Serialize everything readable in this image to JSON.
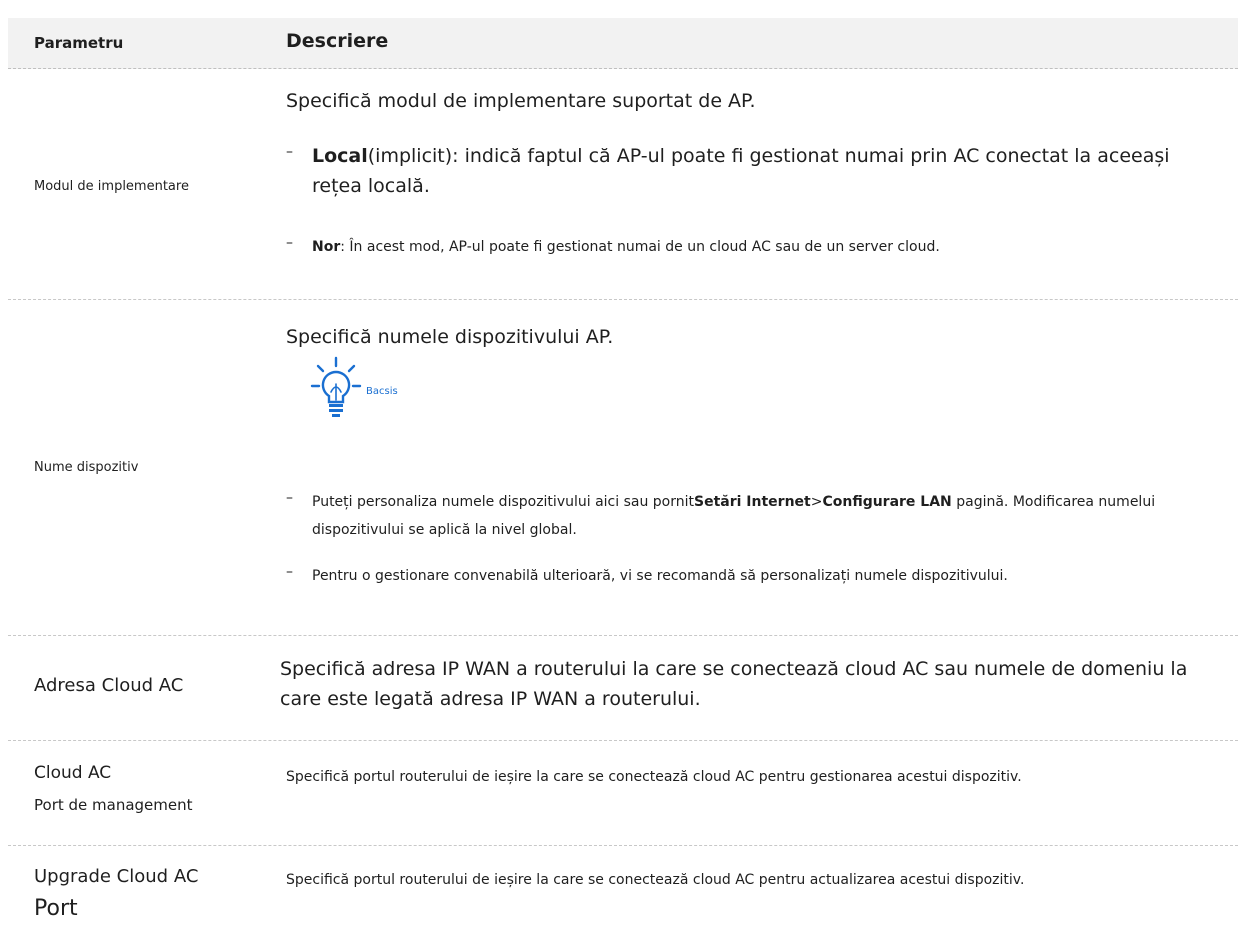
{
  "header": {
    "parameter": "Parametru",
    "description": "Descriere"
  },
  "rows": [
    {
      "param": "Modul de implementare",
      "lead": "Specifică modul de implementare suportat de AP.",
      "bullets": [
        {
          "bold": "Local",
          "text": "(implicit): indică faptul că AP-ul poate fi gestionat numai prin AC conectat la aceeași rețea locală."
        },
        {
          "bold": "Nor",
          "text": ": În acest mod, AP-ul poate fi gestionat numai de un cloud AC sau de un server cloud."
        }
      ]
    },
    {
      "param": "Nume dispozitiv",
      "lead": "Specifică numele dispozitivului AP.",
      "tip_label": "Bacsis",
      "bullets": [
        {
          "text1": "Puteți personaliza numele dispozitivului aici sau pornit",
          "bold1": "Setări Internet",
          "sep": ">",
          "bold2": "Configurare LAN",
          "text2": " pagină. Modificarea numelui dispozitivului se aplică la nivel global."
        },
        {
          "text": "Pentru o gestionare convenabilă ulterioară, vi se recomandă să personalizați numele dispozitivului."
        }
      ]
    },
    {
      "param": "Adresa Cloud AC",
      "desc": "Specifică adresa IP WAN a routerului la care se conectează cloud AC sau numele de domeniu la care este legată adresa IP WAN a routerului."
    },
    {
      "param_line1": "Cloud AC",
      "param_line2": "Port de management",
      "desc": "Specifică portul routerului de ieșire la care se conectează cloud AC pentru gestionarea acestui dispozitiv."
    },
    {
      "param_line1": "Upgrade Cloud AC",
      "param_line2": "Port",
      "desc": "Specifică portul routerului de ieșire la care se conectează cloud AC pentru actualizarea acestui dispozitiv."
    }
  ]
}
